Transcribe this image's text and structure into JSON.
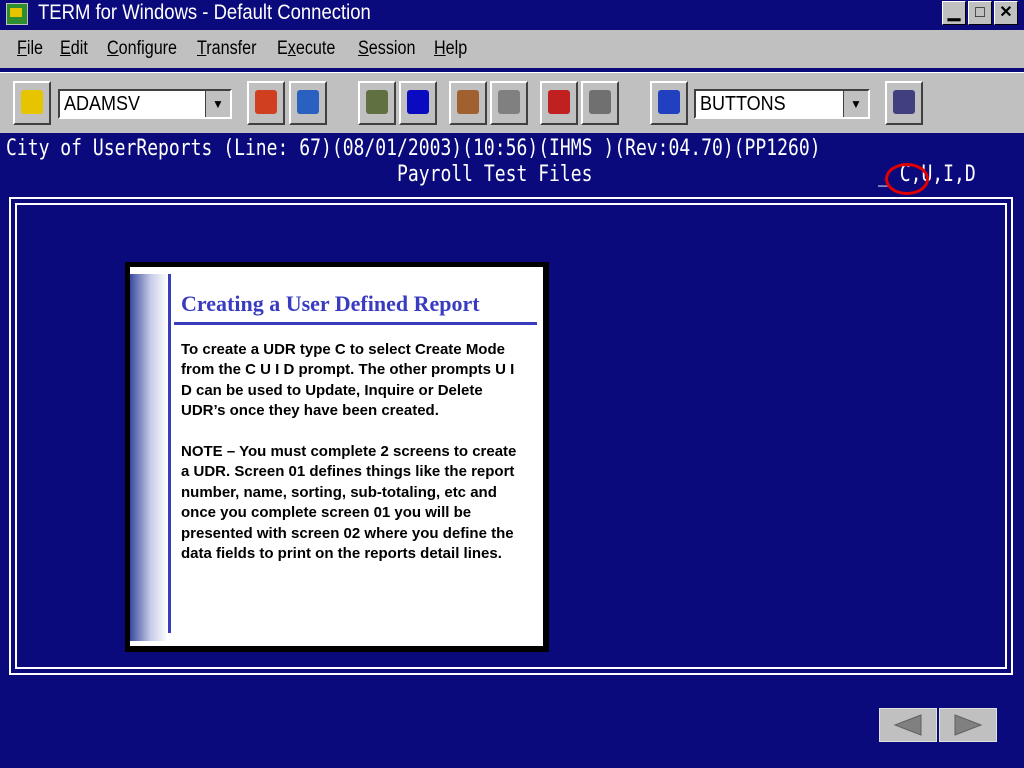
{
  "window": {
    "title": "TERM for Windows - Default Connection",
    "min": "▁",
    "max": "□",
    "close": "✕"
  },
  "menu": [
    {
      "u": "F",
      "rest": "ile"
    },
    {
      "u": "E",
      "rest": "dit"
    },
    {
      "u": "C",
      "rest": "onfigure"
    },
    {
      "u": "T",
      "rest": "ransfer"
    },
    {
      "pre": "E",
      "u": "x",
      "rest": "ecute"
    },
    {
      "u": "S",
      "rest": "ession"
    },
    {
      "u": "H",
      "rest": "elp"
    }
  ],
  "toolbar": {
    "user_combo": "ADAMSV",
    "buttons_combo": "BUTTONS",
    "arrow": "▼"
  },
  "terminal": {
    "line1": "City of UserReports    (Line: 67)(08/01/2003)(10:56)(IHMS     )(Rev:04.70)(PP1260)",
    "line2": "Payroll Test Files",
    "cuid": "_ C,U,I,D"
  },
  "card": {
    "title": "Creating a User Defined Report",
    "para1": "To create a UDR type C to select Create Mode from the C U I D prompt. The other prompts U I D can be used to Update, Inquire or Delete UDR’s once they have been created.",
    "para2": "NOTE – You must complete 2 screens to create a UDR.  Screen 01 defines things like the report number, name, sorting, sub-totaling, etc  and once you complete screen 01 you will be presented with screen 02 where you define the data fields to print on the reports detail lines."
  },
  "colors": {
    "terminal_bg": "#0a0a7c",
    "accent_blue": "#3a3cc0",
    "highlight_circle": "#e00000"
  }
}
